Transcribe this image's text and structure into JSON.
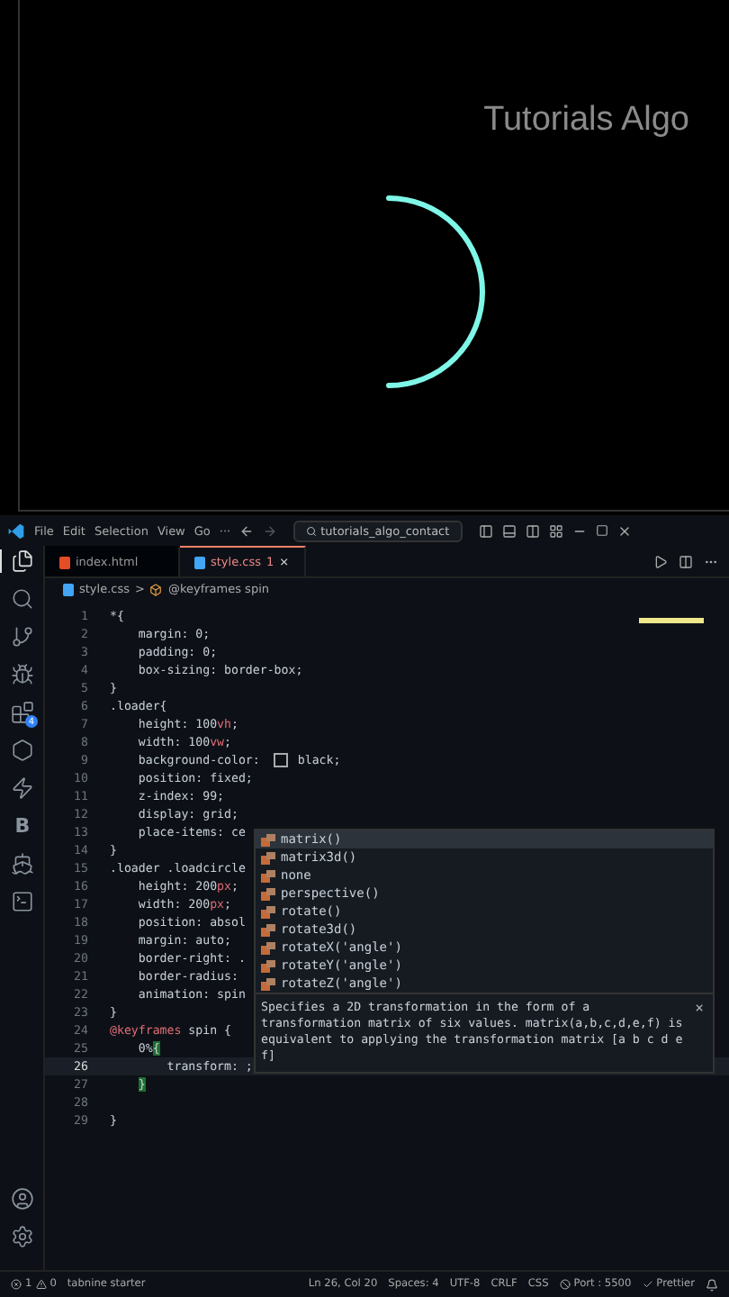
{
  "preview": {
    "brand": "Tutorials Algo"
  },
  "title_bar": {
    "menu": [
      "File",
      "Edit",
      "Selection",
      "View",
      "Go",
      "···"
    ],
    "search": "tutorials_algo_contact"
  },
  "activity_bar": {
    "items": [
      {
        "kind": "files",
        "selected": true
      },
      {
        "kind": "search",
        "selected": false
      },
      {
        "kind": "git",
        "selected": false
      },
      {
        "kind": "debug",
        "selected": false
      },
      {
        "kind": "extensions",
        "selected": false,
        "badge": "4"
      },
      {
        "kind": "hexagon",
        "selected": false
      },
      {
        "kind": "bolt",
        "selected": false
      },
      {
        "kind": "letter",
        "selected": false,
        "text": "B"
      },
      {
        "kind": "whale",
        "selected": false
      },
      {
        "kind": "terminal",
        "selected": false
      }
    ],
    "bottom": [
      {
        "kind": "account"
      },
      {
        "kind": "settings"
      }
    ]
  },
  "tabs": [
    {
      "label": "index.html",
      "kind": "html",
      "selected": false
    },
    {
      "label": "style.css",
      "kind": "css",
      "selected": true,
      "problems": "1",
      "close": "×"
    }
  ],
  "breadcrumb": {
    "file": "style.css",
    "separator": ">",
    "symbol": "@keyframes spin"
  },
  "editor": {
    "lines": [
      {
        "n": "1",
        "current": false,
        "tokens": [
          {
            "t": "*{",
            "kind": "plain"
          }
        ]
      },
      {
        "n": "2",
        "current": false,
        "tokens": [
          {
            "t": "    margin: 0;",
            "kind": "plain"
          }
        ]
      },
      {
        "n": "3",
        "current": false,
        "tokens": [
          {
            "t": "    padding: 0;",
            "kind": "plain"
          }
        ]
      },
      {
        "n": "4",
        "current": false,
        "tokens": [
          {
            "t": "    box-sizing: border-box;",
            "kind": "plain"
          }
        ]
      },
      {
        "n": "5",
        "current": false,
        "tokens": [
          {
            "t": "}",
            "kind": "plain"
          }
        ]
      },
      {
        "n": "6",
        "current": false,
        "tokens": [
          {
            "t": ".loader{",
            "kind": "plain"
          }
        ]
      },
      {
        "n": "7",
        "current": false,
        "tokens": [
          {
            "t": "    height: 100",
            "kind": "plain"
          },
          {
            "t": "vh",
            "kind": "unit"
          },
          {
            "t": ";",
            "kind": "plain"
          }
        ]
      },
      {
        "n": "8",
        "current": false,
        "tokens": [
          {
            "t": "    width: 100",
            "kind": "plain"
          },
          {
            "t": "vw",
            "kind": "unit"
          },
          {
            "t": ";",
            "kind": "plain"
          }
        ]
      },
      {
        "n": "9",
        "current": false,
        "tokens": [
          {
            "t": "    background-color:",
            "kind": "plain"
          },
          {
            "kind": "swatch"
          },
          {
            "t": "black;",
            "kind": "plain"
          }
        ]
      },
      {
        "n": "10",
        "current": false,
        "tokens": [
          {
            "t": "    position: fixed;",
            "kind": "plain"
          }
        ]
      },
      {
        "n": "11",
        "current": false,
        "tokens": [
          {
            "t": "    z-index: 99;",
            "kind": "plain"
          }
        ]
      },
      {
        "n": "12",
        "current": false,
        "tokens": [
          {
            "t": "    display: grid;",
            "kind": "plain"
          }
        ]
      },
      {
        "n": "13",
        "current": false,
        "tokens": [
          {
            "t": "    place-items: ce",
            "kind": "plain"
          }
        ]
      },
      {
        "n": "14",
        "current": false,
        "tokens": [
          {
            "t": "}",
            "kind": "plain"
          }
        ]
      },
      {
        "n": "15",
        "current": false,
        "tokens": [
          {
            "t": ".loader .loadcircle",
            "kind": "plain"
          }
        ]
      },
      {
        "n": "16",
        "current": false,
        "tokens": [
          {
            "t": "    height: 200",
            "kind": "plain"
          },
          {
            "t": "px",
            "kind": "unit"
          },
          {
            "t": ";",
            "kind": "plain"
          }
        ]
      },
      {
        "n": "17",
        "current": false,
        "tokens": [
          {
            "t": "    width: 200",
            "kind": "plain"
          },
          {
            "t": "px",
            "kind": "unit"
          },
          {
            "t": ";",
            "kind": "plain"
          }
        ]
      },
      {
        "n": "18",
        "current": false,
        "tokens": [
          {
            "t": "    position: absol",
            "kind": "plain"
          }
        ]
      },
      {
        "n": "19",
        "current": false,
        "tokens": [
          {
            "t": "    margin: auto;",
            "kind": "plain"
          }
        ]
      },
      {
        "n": "20",
        "current": false,
        "tokens": [
          {
            "t": "    border-right: .",
            "kind": "plain"
          }
        ]
      },
      {
        "n": "21",
        "current": false,
        "tokens": [
          {
            "t": "    border-radius:",
            "kind": "plain"
          }
        ]
      },
      {
        "n": "22",
        "current": false,
        "tokens": [
          {
            "t": "    animation: spin",
            "kind": "plain"
          }
        ]
      },
      {
        "n": "23",
        "current": false,
        "tokens": [
          {
            "t": "}",
            "kind": "plain"
          }
        ]
      },
      {
        "n": "24",
        "current": false,
        "tokens": [
          {
            "t": "@keyframes",
            "kind": "at"
          },
          {
            "t": " spin {",
            "kind": "plain"
          }
        ]
      },
      {
        "n": "25",
        "current": false,
        "tokens": [
          {
            "t": "    0%",
            "kind": "plain"
          },
          {
            "t": "{",
            "kind": "bracket"
          }
        ]
      },
      {
        "n": "26",
        "current": true,
        "tokens": [
          {
            "t": "        transform: ;",
            "kind": "plain"
          }
        ]
      },
      {
        "n": "27",
        "current": false,
        "tokens": [
          {
            "t": "}",
            "kind": "bracket"
          }
        ]
      },
      {
        "n": "28",
        "current": false
      },
      {
        "n": "29",
        "current": false,
        "tokens": [
          {
            "t": "}",
            "kind": "plain"
          }
        ]
      }
    ]
  },
  "suggest": {
    "items": [
      {
        "label": "matrix()",
        "selected": true
      },
      {
        "label": "matrix3d()",
        "selected": false
      },
      {
        "label": "none",
        "selected": false
      },
      {
        "label": "perspective()",
        "selected": false
      },
      {
        "label": "rotate()",
        "selected": false
      },
      {
        "label": "rotate3d()",
        "selected": false
      },
      {
        "label": "rotateX('angle')",
        "selected": false
      },
      {
        "label": "rotateY('angle')",
        "selected": false
      },
      {
        "label": "rotateZ('angle')",
        "selected": false
      }
    ],
    "details": "Specifies a 2D transformation in the form of a transformation matrix of six values. matrix(a,b,c,d,e,f) is equivalent to applying the transformation matrix [a b c d e f]",
    "close": "×"
  },
  "status_bar": {
    "errors": "1",
    "warnings": "0",
    "tabnine": "tabnine starter",
    "items": [
      "Ln 26, Col 20",
      "Spaces: 4",
      "UTF-8",
      "CRLF",
      "CSS"
    ],
    "port": "Port : 5500",
    "prettier": "Prettier"
  }
}
